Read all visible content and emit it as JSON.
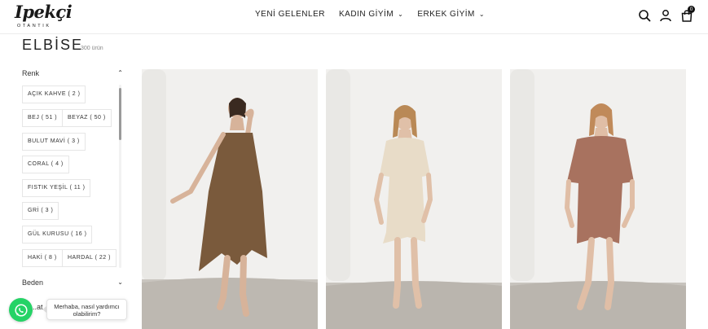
{
  "header": {
    "logo_script": "Ipekçi",
    "logo_sub": "OTANTIK",
    "nav": [
      {
        "label": "YENİ GELENLER",
        "has_dropdown": false
      },
      {
        "label": "KADIN GİYİM",
        "has_dropdown": true
      },
      {
        "label": "ERKEK GİYİM",
        "has_dropdown": true
      }
    ],
    "icons": [
      "search-icon",
      "user-icon",
      "cart-icon"
    ],
    "cart_count": "0"
  },
  "page": {
    "title": "ELBİSE",
    "count": "300 ürün"
  },
  "filters": {
    "color": {
      "label": "Renk",
      "expanded": true,
      "options": [
        {
          "label": "AÇIK KAHVE ( 2 )"
        },
        {
          "label": "BEJ ( 51 )"
        },
        {
          "label": "BEYAZ ( 50 )"
        },
        {
          "label": "BULUT MAVİ ( 3 )"
        },
        {
          "label": "CORAL ( 4 )"
        },
        {
          "label": "FISTIK YEŞİL ( 11 )"
        },
        {
          "label": "GRİ ( 3 )"
        },
        {
          "label": "GÜL KURUSU ( 16 )"
        },
        {
          "label": "HAKİ ( 8 )"
        },
        {
          "label": "HARDAL ( 22 )"
        }
      ]
    },
    "size": {
      "label": "Beden",
      "expanded": false
    },
    "partially_hidden_label": "..at"
  },
  "products": [
    {
      "image": "woman-brown-slip-dress",
      "dress_color": "#7a5a3c"
    },
    {
      "image": "woman-cream-tunic-dress",
      "dress_color": "#e8dcc8"
    },
    {
      "image": "woman-terracotta-tunic-dress",
      "dress_color": "#a8725f"
    }
  ],
  "chat": {
    "bubble_text": "Merhaba, nasıl yardımcı olabilirim?",
    "accent": "#25d366"
  }
}
